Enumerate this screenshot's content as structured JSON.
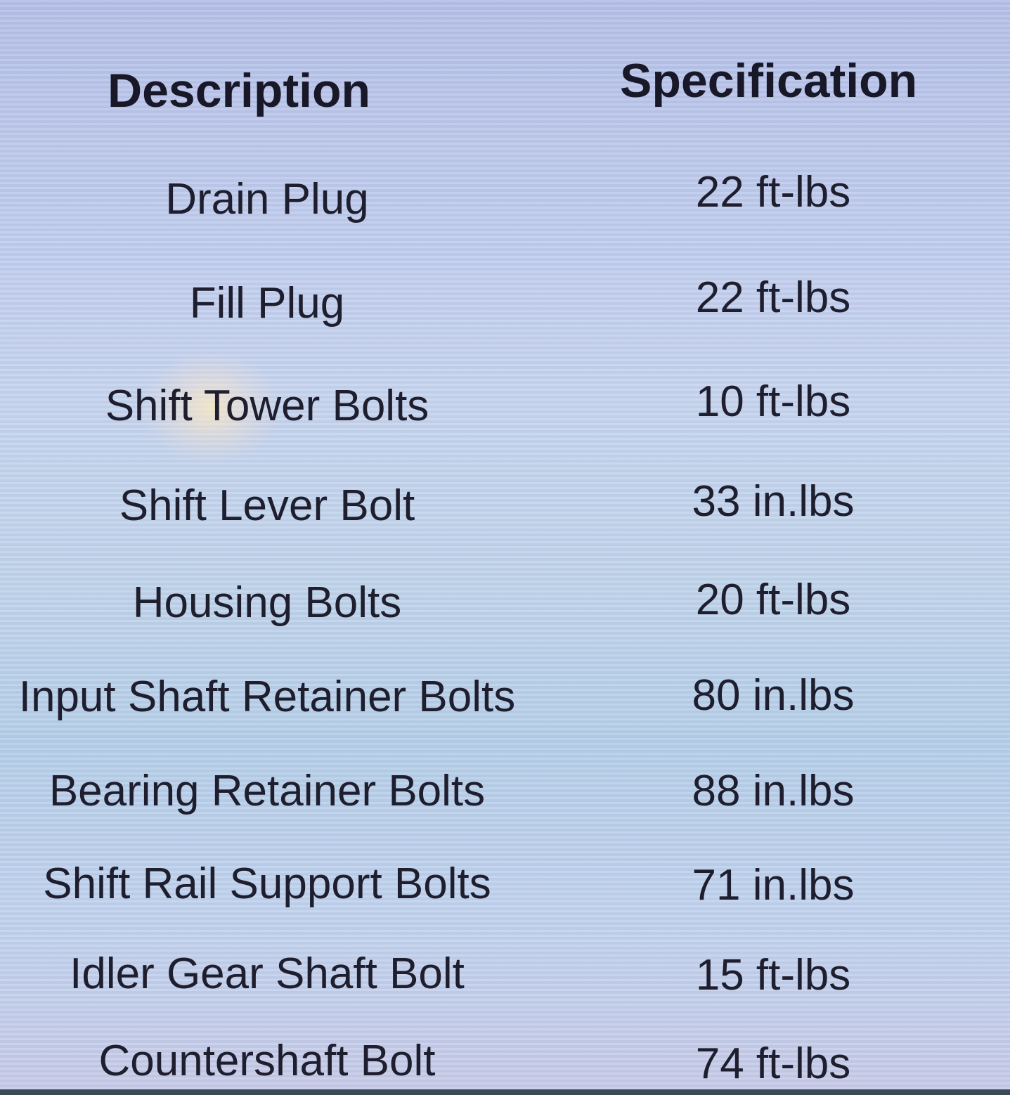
{
  "table": {
    "headers": {
      "description": "Description",
      "specification": "Specification"
    },
    "rows": [
      {
        "description": "Drain Plug",
        "specification": "22 ft-lbs"
      },
      {
        "description": "Fill Plug",
        "specification": "22 ft-lbs"
      },
      {
        "description": "Shift Tower Bolts",
        "specification": "10 ft-lbs"
      },
      {
        "description": "Shift Lever Bolt",
        "specification": "33 in.lbs"
      },
      {
        "description": "Housing Bolts",
        "specification": "20 ft-lbs"
      },
      {
        "description": "Input Shaft Retainer Bolts",
        "specification": "80 in.lbs"
      },
      {
        "description": "Bearing Retainer Bolts",
        "specification": "88 in.lbs"
      },
      {
        "description": "Shift Rail Support Bolts",
        "specification": "71 in.lbs"
      },
      {
        "description": "Idler Gear Shaft Bolt",
        "specification": "15 ft-lbs"
      },
      {
        "description": "Countershaft Bolt",
        "specification": "74 ft-lbs"
      }
    ]
  }
}
